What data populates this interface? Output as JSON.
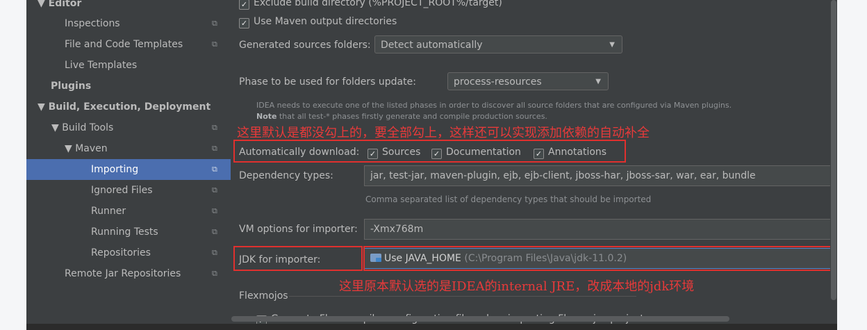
{
  "sidebar": {
    "items": [
      {
        "label": "▼ Editor",
        "has_copy": false,
        "bold": true
      },
      {
        "label": "Inspections",
        "has_copy": true
      },
      {
        "label": "File and Code Templates",
        "has_copy": true
      },
      {
        "label": "Live Templates",
        "has_copy": false
      },
      {
        "label": "Plugins",
        "has_copy": false,
        "bold": true
      },
      {
        "label": "▼ Build, Execution, Deployment",
        "has_copy": false,
        "bold": true
      },
      {
        "label": "▼ Build Tools",
        "has_copy": true
      },
      {
        "label": "▼ Maven",
        "has_copy": true
      },
      {
        "label": "Importing",
        "has_copy": true,
        "selected": true
      },
      {
        "label": "Ignored Files",
        "has_copy": true
      },
      {
        "label": "Runner",
        "has_copy": true
      },
      {
        "label": "Running Tests",
        "has_copy": true
      },
      {
        "label": "Repositories",
        "has_copy": true
      },
      {
        "label": "Remote Jar Repositories",
        "has_copy": true
      }
    ],
    "copy_icon_glyph": "⧉"
  },
  "main": {
    "exclude_build_dir": {
      "label": "Exclude build directory (%PROJECT_ROOT%/target)",
      "checked": true
    },
    "use_maven_output": {
      "label": "Use Maven output directories",
      "checked": true
    },
    "generated_sources": {
      "label": "Generated sources folders:",
      "value": "Detect automatically"
    },
    "phase": {
      "label": "Phase to be used for folders update:",
      "value": "process-resources"
    },
    "phase_hint_1": "IDEA needs to execute one of the listed phases in order to discover all source folders that are configured via Maven plugins.",
    "phase_hint_2_bold": "Note",
    "phase_hint_2_rest": " that all test-* phases firstly generate and compile production sources.",
    "annotation_1": "这里默认是都没勾上的，要全部勾上，这样还可以实现添加依赖的自动补全",
    "auto_download": {
      "label": "Automatically download:",
      "sources": "Sources",
      "documentation": "Documentation",
      "annotations": "Annotations"
    },
    "dependency_types": {
      "label": "Dependency types:",
      "value": "jar, test-jar, maven-plugin, ejb, ejb-client, jboss-har, jboss-sar, war, ear, bundle",
      "hint": "Comma separated list of dependency types that should be imported"
    },
    "vm_options": {
      "label": "VM options for importer:",
      "value": "-Xmx768m"
    },
    "jdk": {
      "label": "JDK for importer:",
      "value": "Use JAVA_HOME",
      "path": " (C:\\Program Files\\Java\\jdk-11.0.2)"
    },
    "annotation_2": "这里原本默认选的是IDEA的internal JRE，改成本地的jdk环境",
    "flexmojos": {
      "title": "Flexmojos",
      "generate_config": "Generate Flex compiler configuration files when importing Flexmojos projects"
    }
  },
  "colors": {
    "background": "#3c3f41",
    "selection": "#4b6eaf",
    "annotation_red": "#e83a3a",
    "text": "#bbbbbb"
  }
}
